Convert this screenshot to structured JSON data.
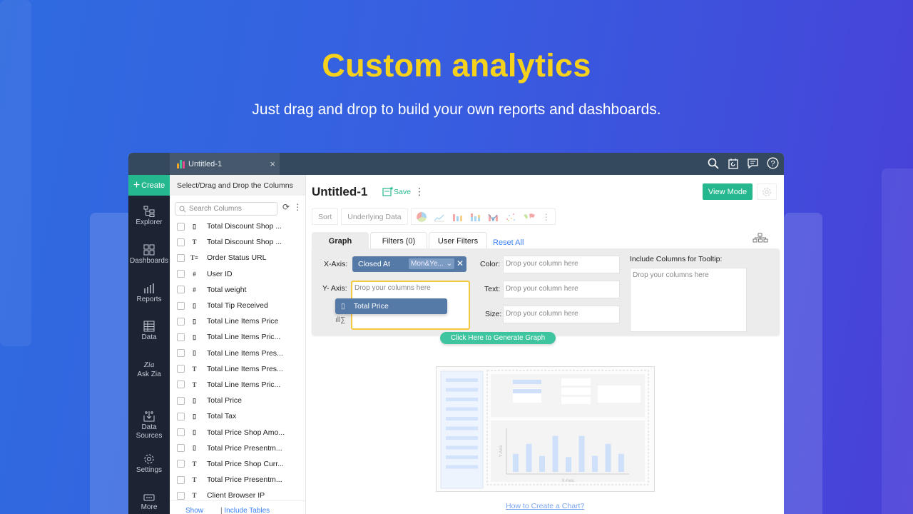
{
  "hero": {
    "title": "Custom analytics",
    "subtitle": "Just drag and drop to build your own reports and dashboards.",
    "title_color": "#f7d21c"
  },
  "app": {
    "tab": {
      "title": "Untitled-1",
      "close": "×"
    },
    "top_icons": [
      "search-icon",
      "calendar-refresh-icon",
      "comment-icon",
      "help-icon"
    ],
    "create_label": "Create",
    "nav": [
      {
        "label": "Explorer",
        "icon": "explorer-icon"
      },
      {
        "label": "Dashboards",
        "icon": "dashboards-icon"
      },
      {
        "label": "Reports",
        "icon": "reports-icon"
      },
      {
        "label": "Data",
        "icon": "data-table-icon"
      },
      {
        "label": "Ask Zia",
        "icon": "zia-icon"
      },
      {
        "label": "Data Sources",
        "icon": "data-sources-icon"
      },
      {
        "label": "Settings",
        "icon": "settings-icon"
      },
      {
        "label": "More",
        "icon": "more-icon"
      }
    ],
    "columns_panel": {
      "header": "Select/Drag and Drop the Columns",
      "search_placeholder": "Search Columns",
      "columns": [
        {
          "type": "currency",
          "name": "Total Discount Shop ..."
        },
        {
          "type": "text",
          "name": "Total Discount Shop ..."
        },
        {
          "type": "url",
          "name": "Order Status URL"
        },
        {
          "type": "number",
          "name": "User ID"
        },
        {
          "type": "number",
          "name": "Total weight"
        },
        {
          "type": "currency",
          "name": "Total Tip Received"
        },
        {
          "type": "currency",
          "name": "Total Line Items Price"
        },
        {
          "type": "currency",
          "name": "Total Line Items Pric..."
        },
        {
          "type": "currency",
          "name": "Total Line Items Pres..."
        },
        {
          "type": "text",
          "name": "Total Line Items Pres..."
        },
        {
          "type": "text",
          "name": "Total Line Items Pric..."
        },
        {
          "type": "currency",
          "name": "Total Price"
        },
        {
          "type": "currency",
          "name": "Total Tax"
        },
        {
          "type": "currency",
          "name": "Total Price Shop Amo..."
        },
        {
          "type": "currency",
          "name": "Total Price Presentm..."
        },
        {
          "type": "text",
          "name": "Total Price Shop Curr..."
        },
        {
          "type": "text",
          "name": "Total Price Presentm..."
        },
        {
          "type": "text",
          "name": "Client Browser IP"
        }
      ],
      "footer": {
        "show": "Show",
        "include_tables": "Include Tables"
      }
    },
    "report": {
      "title": "Untitled-1",
      "save_label": "Save",
      "view_mode_label": "View Mode",
      "toolbar": {
        "sort": "Sort",
        "underlying_data": "Underlying Data"
      },
      "chart_types": [
        "pie-chart-icon",
        "line-chart-icon",
        "bar-chart-icon",
        "stacked-bar-icon",
        "combo-chart-icon",
        "scatter-chart-icon",
        "map-chart-icon"
      ],
      "tabs": [
        {
          "label": "Graph",
          "active": true
        },
        {
          "label": "Filters (0)",
          "active": false
        },
        {
          "label": "User Filters",
          "active": false
        }
      ],
      "reset_all": "Reset All",
      "config": {
        "x_axis_label": "X-Axis:",
        "x_axis_value": "Closed At",
        "x_axis_agg": "Mon&Ye...",
        "y_axis_label": "Y- Axis:",
        "y_axis_placeholder": "Drop your columns here",
        "dragging_column": "Total Price",
        "color_label": "Color:",
        "text_label": "Text:",
        "size_label": "Size:",
        "column_placeholder": "Drop your column here",
        "tooltip_label": "Include Columns for Tooltip:",
        "tooltip_placeholder": "Drop your columns here"
      },
      "generate_label": "Click Here to Generate Graph",
      "illustration": {
        "x_label": "X-Axis",
        "y_label": "Y-Axis",
        "bar_levels": [
          0.45,
          0.7,
          0.4,
          0.9,
          0.37,
          0.9,
          0.4,
          0.7,
          0.45
        ]
      },
      "how_to_link": "How to Create a Chart?"
    }
  }
}
